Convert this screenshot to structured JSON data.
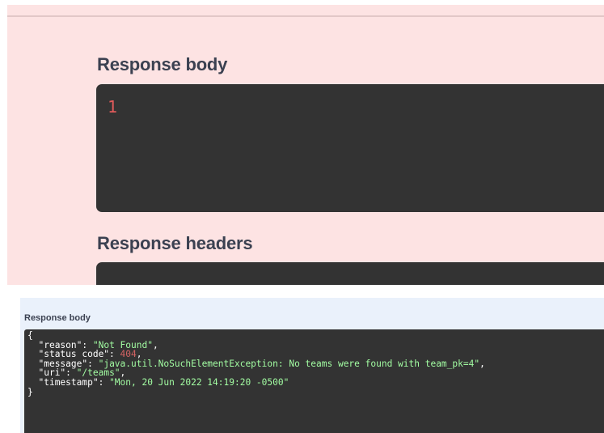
{
  "top_panel": {
    "response_body_heading": "Response body",
    "response_body_value": "1",
    "response_headers_heading": "Response headers",
    "colors": {
      "background": "#fde3e3",
      "code_bg": "#333333",
      "number": "#e25b5b"
    }
  },
  "bottom_panel": {
    "response_body_heading": "Response body",
    "json": {
      "open": "{",
      "close": "}",
      "lines": [
        {
          "key": "\"reason\"",
          "value": "\"Not Found\"",
          "type": "string",
          "comma": ","
        },
        {
          "key": "\"status code\"",
          "value": "404",
          "type": "number",
          "comma": ","
        },
        {
          "key": "\"message\"",
          "value": "\"java.util.NoSuchElementException: No teams were found with team_pk=4\"",
          "type": "string",
          "comma": ","
        },
        {
          "key": "\"uri\"",
          "value": "\"/teams\"",
          "type": "string",
          "comma": ","
        },
        {
          "key": "\"timestamp\"",
          "value": "\"Mon, 20 Jun 2022 14:19:20 -0500\"",
          "type": "string",
          "comma": ""
        }
      ]
    },
    "colors": {
      "background": "#eaf1fb",
      "code_bg": "#333333",
      "string": "#a2fca2",
      "number": "#d36363"
    }
  }
}
